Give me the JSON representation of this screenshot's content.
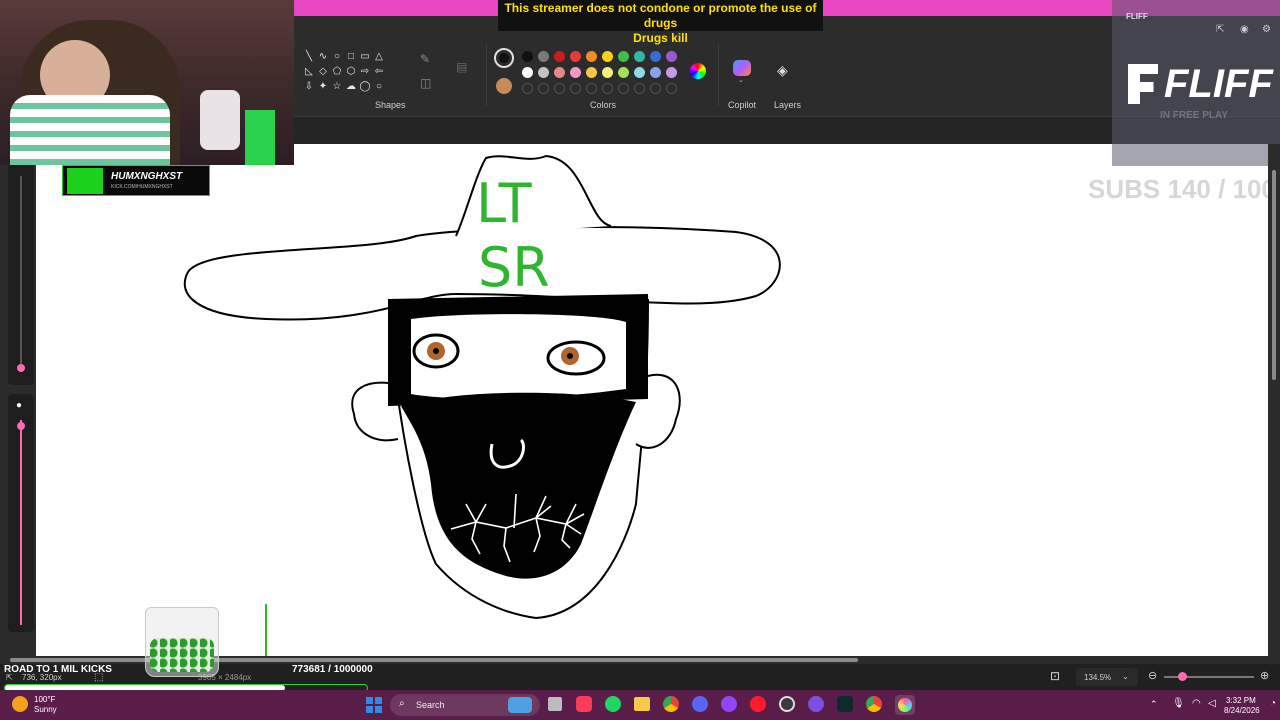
{
  "disclaimer": {
    "line1": "This streamer does not condone or promote the use of drugs",
    "line2": "Drugs kill"
  },
  "ribbon": {
    "shapes_label": "Shapes",
    "colors_label": "Colors",
    "copilot_label": "Copilot",
    "layers_label": "Layers",
    "shape_glyphs": [
      "╲",
      "∿",
      "○",
      "□",
      "▭",
      "△",
      "",
      "◺",
      "◇",
      "⬠",
      "⬡",
      "⇨",
      "⇦",
      "",
      "⇩",
      "✦",
      "☆",
      "☁",
      "◯",
      "○",
      ""
    ],
    "palette_row1": [
      "#111111",
      "#7a7a7a",
      "#c81e1e",
      "#e63b3b",
      "#f28c28",
      "#f7d21d",
      "#3fbf4a",
      "#32b6a6",
      "#3a6bd1",
      "#9b59d0"
    ],
    "palette_row2": [
      "#ffffff",
      "#c3c3c3",
      "#e08a8a",
      "#f29ac4",
      "#f7c64a",
      "#f5ee7a",
      "#a4e05c",
      "#8fd9e0",
      "#8aa3e8",
      "#c49ae6"
    ],
    "current_color_primary": "#111111",
    "current_color_secondary": "#c98a5a"
  },
  "webcam": {
    "name": "HUMXNGHXST",
    "url": "KICK.COM/HUMXNGHXST"
  },
  "sponsor": {
    "brand": "FLIFF",
    "small_brand": "FLIFF",
    "promo": "IN FREE PLAY"
  },
  "subs": "SUBS 140 / 100",
  "drawing": {
    "hat_text_line1": "LT",
    "hat_text_line2": "SR"
  },
  "road": {
    "label": "ROAD TO 1 MIL KICKS",
    "count": "773681 / 1000000",
    "progress": 0.773681
  },
  "status": {
    "cursor_pos": "736, 320px",
    "canvas_size": "3985 × 2484px",
    "zoom": "134.5%"
  },
  "taskbar": {
    "weather_temp": "100°F",
    "weather_desc": "Sunny",
    "search_placeholder": "Search",
    "time": "3:32 PM",
    "date": "8/24/2026"
  }
}
